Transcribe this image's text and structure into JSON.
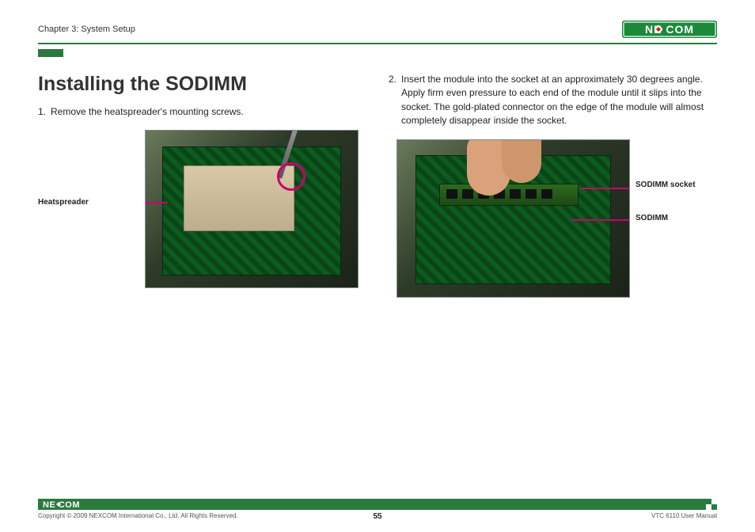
{
  "header": {
    "chapter": "Chapter 3: System Setup",
    "brand": "NEXCOM"
  },
  "content": {
    "title": "Installing the SODIMM",
    "step1_num": "1.",
    "step1_text": "Remove the heatspreader's mounting screws.",
    "step2_num": "2.",
    "step2_text": "Insert the module into the socket at an approximately 30 degrees angle. Apply firm even pressure to each end of the module until it slips into the socket. The gold-plated connector on the edge of the module will almost completely disappear inside the socket.",
    "label_heatspreader": "Heatspreader",
    "label_sodimm_socket": "SODIMM socket",
    "label_sodimm": "SODIMM"
  },
  "footer": {
    "copyright": "Copyright © 2009 NEXCOM International Co., Ltd. All Rights Reserved.",
    "page_number": "55",
    "doc_title": "VTC 6110 User Manual",
    "brand": "NEXCOM"
  }
}
